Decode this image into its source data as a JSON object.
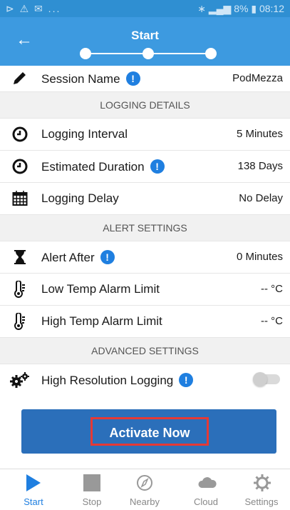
{
  "status_bar": {
    "left_icons": "⊳ ⚠ ✉ ...",
    "battery": "8%",
    "time": "08:12"
  },
  "header": {
    "title": "Start",
    "steps_total": 3,
    "active_step": 1
  },
  "rows": {
    "session_name": {
      "label": "Session Name",
      "value": "PodMezza"
    },
    "logging_interval": {
      "label": "Logging Interval",
      "value": "5 Minutes"
    },
    "estimated_duration": {
      "label": "Estimated Duration",
      "value": "138 Days"
    },
    "logging_delay": {
      "label": "Logging Delay",
      "value": "No Delay"
    },
    "alert_after": {
      "label": "Alert After",
      "value": "0 Minutes"
    },
    "low_temp": {
      "label": "Low Temp Alarm Limit",
      "value": "-- °C"
    },
    "high_temp": {
      "label": "High Temp Alarm Limit",
      "value": "-- °C"
    },
    "high_res": {
      "label": "High Resolution Logging",
      "enabled": false
    }
  },
  "sections": {
    "logging_details": "LOGGING DETAILS",
    "alert_settings": "ALERT SETTINGS",
    "advanced_settings": "ADVANCED SETTINGS"
  },
  "info_glyph": "!",
  "activate_label": "Activate Now",
  "tabs": [
    {
      "label": "Start",
      "icon": "play-icon",
      "active": true
    },
    {
      "label": "Stop",
      "icon": "stop-icon",
      "active": false
    },
    {
      "label": "Nearby",
      "icon": "compass-icon",
      "active": false
    },
    {
      "label": "Cloud",
      "icon": "cloud-icon",
      "active": false
    },
    {
      "label": "Settings",
      "icon": "gear-icon",
      "active": false
    }
  ],
  "colors": {
    "primary": "#3d9ae0",
    "status_bar": "#2f8fd2",
    "button": "#2b6fba",
    "info": "#1f7fe0",
    "highlight": "#e53935"
  }
}
